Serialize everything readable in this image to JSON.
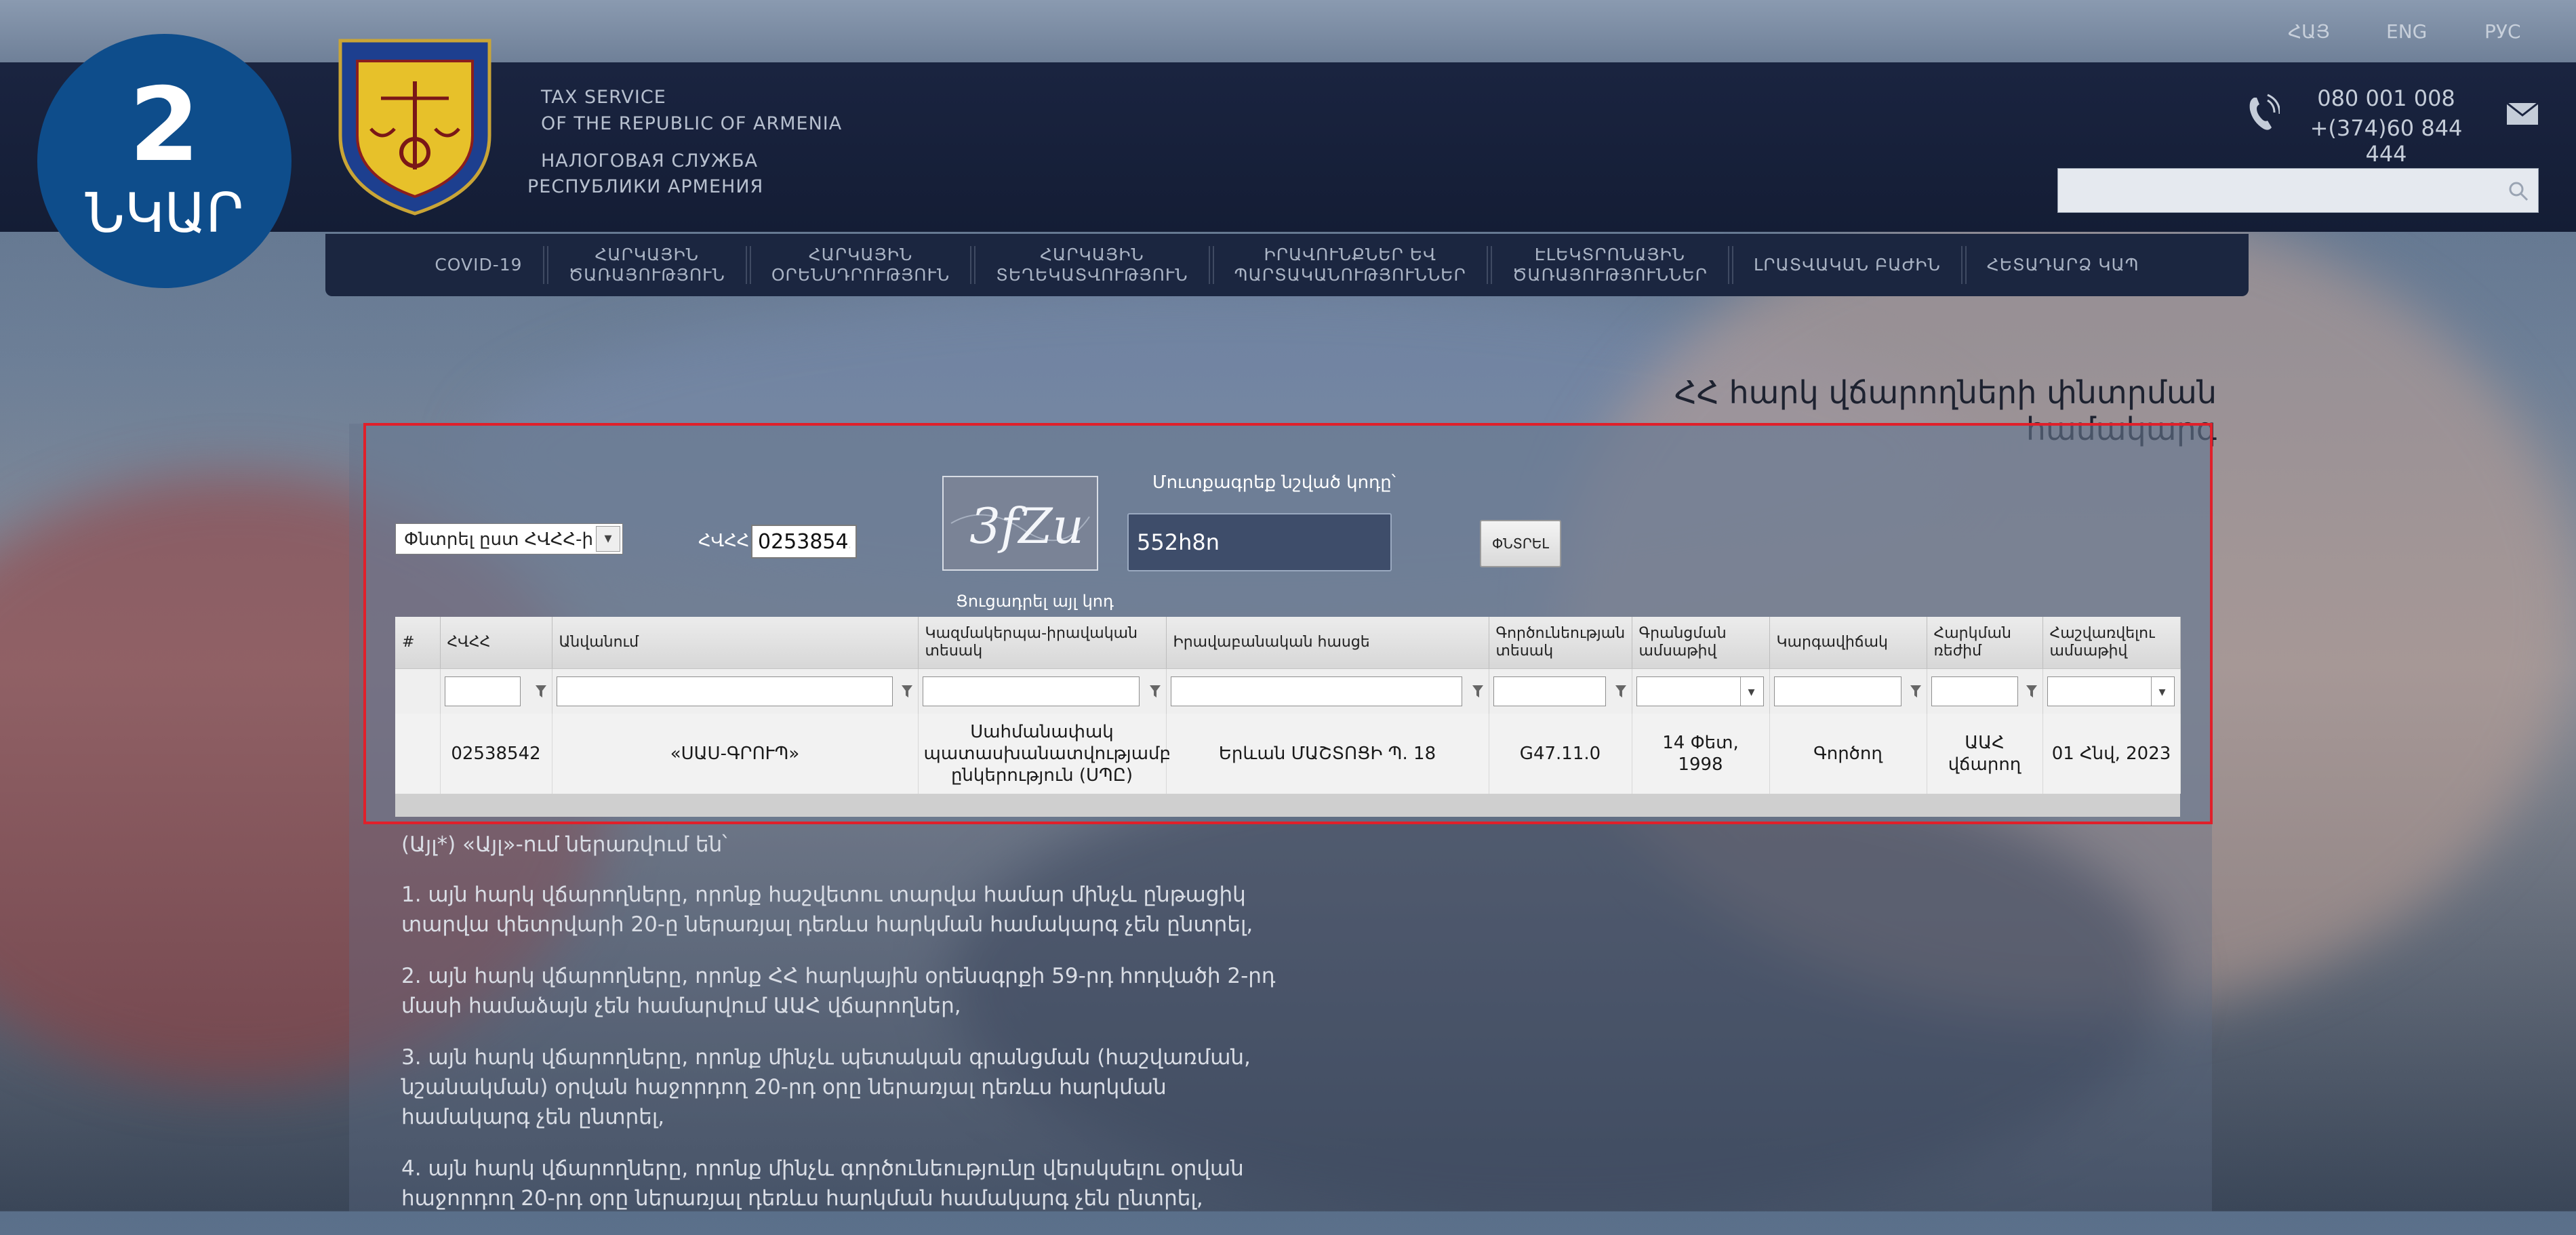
{
  "languages": [
    "ՀԱՅ",
    "ENG",
    "РУС"
  ],
  "badge": {
    "number": "2",
    "label": "ՆԿԱՐ"
  },
  "organization": {
    "en_line1": "TAX SERVICE",
    "en_line2": "OF THE REPUBLIC OF ARMENIA",
    "ru_line1": "НАЛОГОВАЯ СЛУЖБА",
    "ru_line2": "РЕСПУБЛИКИ АРМЕНИЯ"
  },
  "contacts": {
    "phone1": "080 001 008",
    "phone2": "+(374)60 844 444"
  },
  "search": {
    "placeholder": ""
  },
  "nav": [
    {
      "line1": "COVID-19",
      "line2": ""
    },
    {
      "line1": "ՀԱՐԿԱՅԻՆ",
      "line2": "ԾԱՌԱՅՈՒԹՅՈՒՆ"
    },
    {
      "line1": "ՀԱՐԿԱՅԻՆ",
      "line2": "ՕՐԵՆՍԴՐՈՒԹՅՈՒՆ"
    },
    {
      "line1": "ՀԱՐԿԱՅԻՆ",
      "line2": "ՏԵՂԵԿԱՏՎՈՒԹՅՈՒՆ"
    },
    {
      "line1": "ԻՐԱՎՈՒՆՔՆԵՐ ԵՎ",
      "line2": "ՊԱՐՏԱԿԱՆՈՒԹՅՈՒՆՆԵՐ"
    },
    {
      "line1": "ԷԼԵԿՏՐՈՆԱՅԻՆ",
      "line2": "ԾԱՌԱՅՈՒԹՅՈՒՆՆԵՐ"
    },
    {
      "line1": "ԼՐԱՏՎԱԿԱՆ ԲԱԺԻՆ",
      "line2": ""
    },
    {
      "line1": "ՀԵՏԱԴԱՐՁ ԿԱՊ",
      "line2": ""
    }
  ],
  "page_title": "ՀՀ հարկ վճարողների փնտրման համակարգ",
  "form": {
    "filter_select": "Փնտրել ըստ ՀՎՀՀ-ի",
    "tin_label": "ՀՎՀՀ",
    "tin_value": "02538542",
    "captcha_label": "Մուտքագրեք նշված կոդը՝",
    "captcha_text": "3fZu",
    "captcha_value": "552h8n",
    "captcha_refresh": "Ցուցադրել այլ կոդ",
    "search_button": "ՓՆՏՐԵԼ"
  },
  "table": {
    "columns": [
      {
        "label": "#",
        "filter": "none"
      },
      {
        "label": "ՀՎՀՀ",
        "filter": "text"
      },
      {
        "label": "Անվանում",
        "filter": "text"
      },
      {
        "label": "Կազմակերպա-իրավական տեսակ",
        "filter": "text"
      },
      {
        "label": "Իրավաբանական հասցե",
        "filter": "text"
      },
      {
        "label": "Գործունեության տեսակ",
        "filter": "text"
      },
      {
        "label": "Գրանցման ամսաթիվ",
        "filter": "select"
      },
      {
        "label": "Կարգավիճակ",
        "filter": "text"
      },
      {
        "label": "Հարկման ռեժիմ",
        "filter": "text"
      },
      {
        "label": "Հաշվառվելու ամսաթիվ",
        "filter": "select"
      }
    ],
    "rows": [
      [
        "",
        "02538542",
        "«ՍԱՍ-ԳՐՈՒՊ»",
        "Սահմանափակ պատասխանատվությամբ ընկերություն (ՍՊԸ)",
        "Երևան ՄԱՇՏՈՑԻ Պ. 18",
        "G47.11.0",
        "14 Փետ, 1998",
        "Գործող",
        "ԱԱՀ վճարող",
        "01 Հնվ, 2023"
      ]
    ]
  },
  "notes": {
    "heading": "(Այլ*) «Այլ»-ում ներառվում են՝",
    "items": [
      "1. այն հարկ վճարողները, որոնք հաշվետու տարվա համար մինչև ընթացիկ տարվա փետրվարի 20-ը ներառյալ դեռևս հարկման համակարգ չեն ընտրել,",
      "2. այն հարկ վճարողները, որոնք ՀՀ հարկային օրենսգրքի 59-րդ հոդվածի 2-րդ մասի համաձայն չեն համարվում ԱԱՀ վճարողներ,",
      "3. այն հարկ վճարողները, որոնք մինչև պետական գրանցման (հաշվառման, նշանակման) օրվան հաջորդող 20-րդ օրը ներառյալ դեռևս հարկման համակարգ չեն ընտրել,",
      "4. այն հարկ վճարողները, որոնք մինչև գործունեությունը վերսկսելու օրվան հաջորդող 20-րդ օրը ներառյալ դեռևս հարկման համակարգ չեն ընտրել,"
    ]
  },
  "colors": {
    "accent_red": "#e0202a",
    "badge_blue": "#0e4d8b",
    "header_navy": "#141d35"
  }
}
